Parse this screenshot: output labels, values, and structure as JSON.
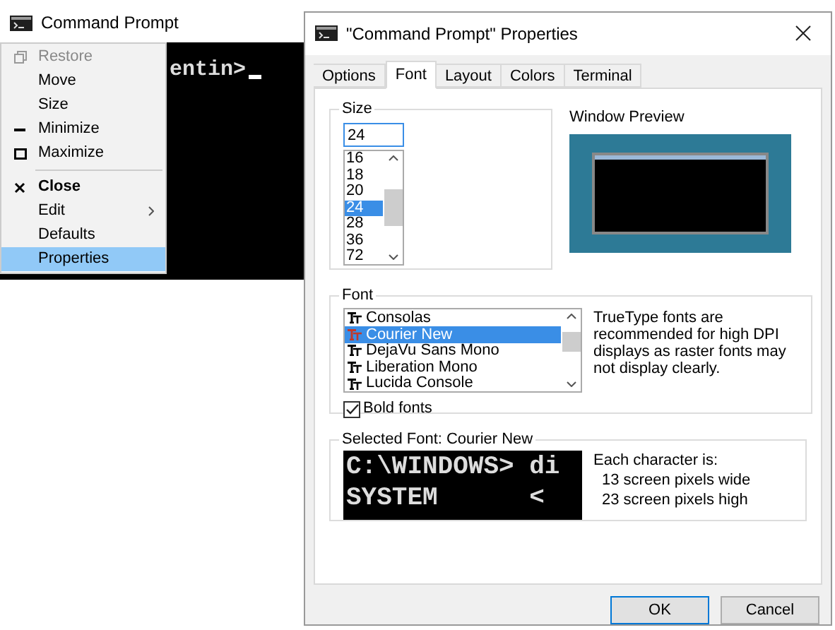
{
  "console_window": {
    "title": "Command Prompt",
    "output": "entin>"
  },
  "system_menu": {
    "items": [
      {
        "label": "Restore",
        "kind": "restore",
        "disabled": true,
        "bold": false,
        "submenu": false,
        "selected": false,
        "separator_after": false
      },
      {
        "label": "Move",
        "kind": "plain",
        "disabled": false,
        "bold": false,
        "submenu": false,
        "selected": false,
        "separator_after": false
      },
      {
        "label": "Size",
        "kind": "plain",
        "disabled": false,
        "bold": false,
        "submenu": false,
        "selected": false,
        "separator_after": false
      },
      {
        "label": "Minimize",
        "kind": "minimize",
        "disabled": false,
        "bold": false,
        "submenu": false,
        "selected": false,
        "separator_after": false
      },
      {
        "label": "Maximize",
        "kind": "maximize",
        "disabled": false,
        "bold": false,
        "submenu": false,
        "selected": false,
        "separator_after": true
      },
      {
        "label": "Close",
        "kind": "close",
        "disabled": false,
        "bold": true,
        "submenu": false,
        "selected": false,
        "separator_after": false
      },
      {
        "label": "Edit",
        "kind": "plain",
        "disabled": false,
        "bold": false,
        "submenu": true,
        "selected": false,
        "separator_after": false
      },
      {
        "label": "Defaults",
        "kind": "plain",
        "disabled": false,
        "bold": false,
        "submenu": false,
        "selected": false,
        "separator_after": false
      },
      {
        "label": "Properties",
        "kind": "plain",
        "disabled": false,
        "bold": false,
        "submenu": false,
        "selected": true,
        "separator_after": false
      }
    ]
  },
  "dialog": {
    "title": "\"Command Prompt\" Properties",
    "tabs": [
      {
        "label": "Options",
        "selected": false
      },
      {
        "label": "Font",
        "selected": true
      },
      {
        "label": "Layout",
        "selected": false
      },
      {
        "label": "Colors",
        "selected": false
      },
      {
        "label": "Terminal",
        "selected": false
      }
    ],
    "size_group": {
      "label": "Size",
      "value": "24",
      "options": [
        {
          "label": "16",
          "selected": false
        },
        {
          "label": "18",
          "selected": false
        },
        {
          "label": "20",
          "selected": false
        },
        {
          "label": "24",
          "selected": true
        },
        {
          "label": "28",
          "selected": false
        },
        {
          "label": "36",
          "selected": false
        },
        {
          "label": "72",
          "selected": false
        }
      ]
    },
    "window_preview": {
      "label": "Window Preview"
    },
    "font_group": {
      "label": "Font",
      "fonts": [
        {
          "label": "Consolas",
          "selected": false
        },
        {
          "label": "Courier New",
          "selected": true
        },
        {
          "label": "DejaVu Sans Mono",
          "selected": false
        },
        {
          "label": "Liberation Mono",
          "selected": false
        },
        {
          "label": "Lucida Console",
          "selected": false
        }
      ],
      "bold_fonts": {
        "label": "Bold fonts",
        "checked": true
      },
      "note": "TrueType fonts are recommended for high DPI displays as raster fonts may not display clearly."
    },
    "selected_font": {
      "label": "Selected Font: Courier New",
      "sample_lines": [
        "C:\\WINDOWS> di",
        "SYSTEM      <"
      ],
      "info": [
        "Each character is:",
        "13 screen pixels wide",
        "23 screen pixels high"
      ]
    },
    "buttons": [
      {
        "label": "OK",
        "default": true
      },
      {
        "label": "Cancel",
        "default": false
      }
    ]
  }
}
